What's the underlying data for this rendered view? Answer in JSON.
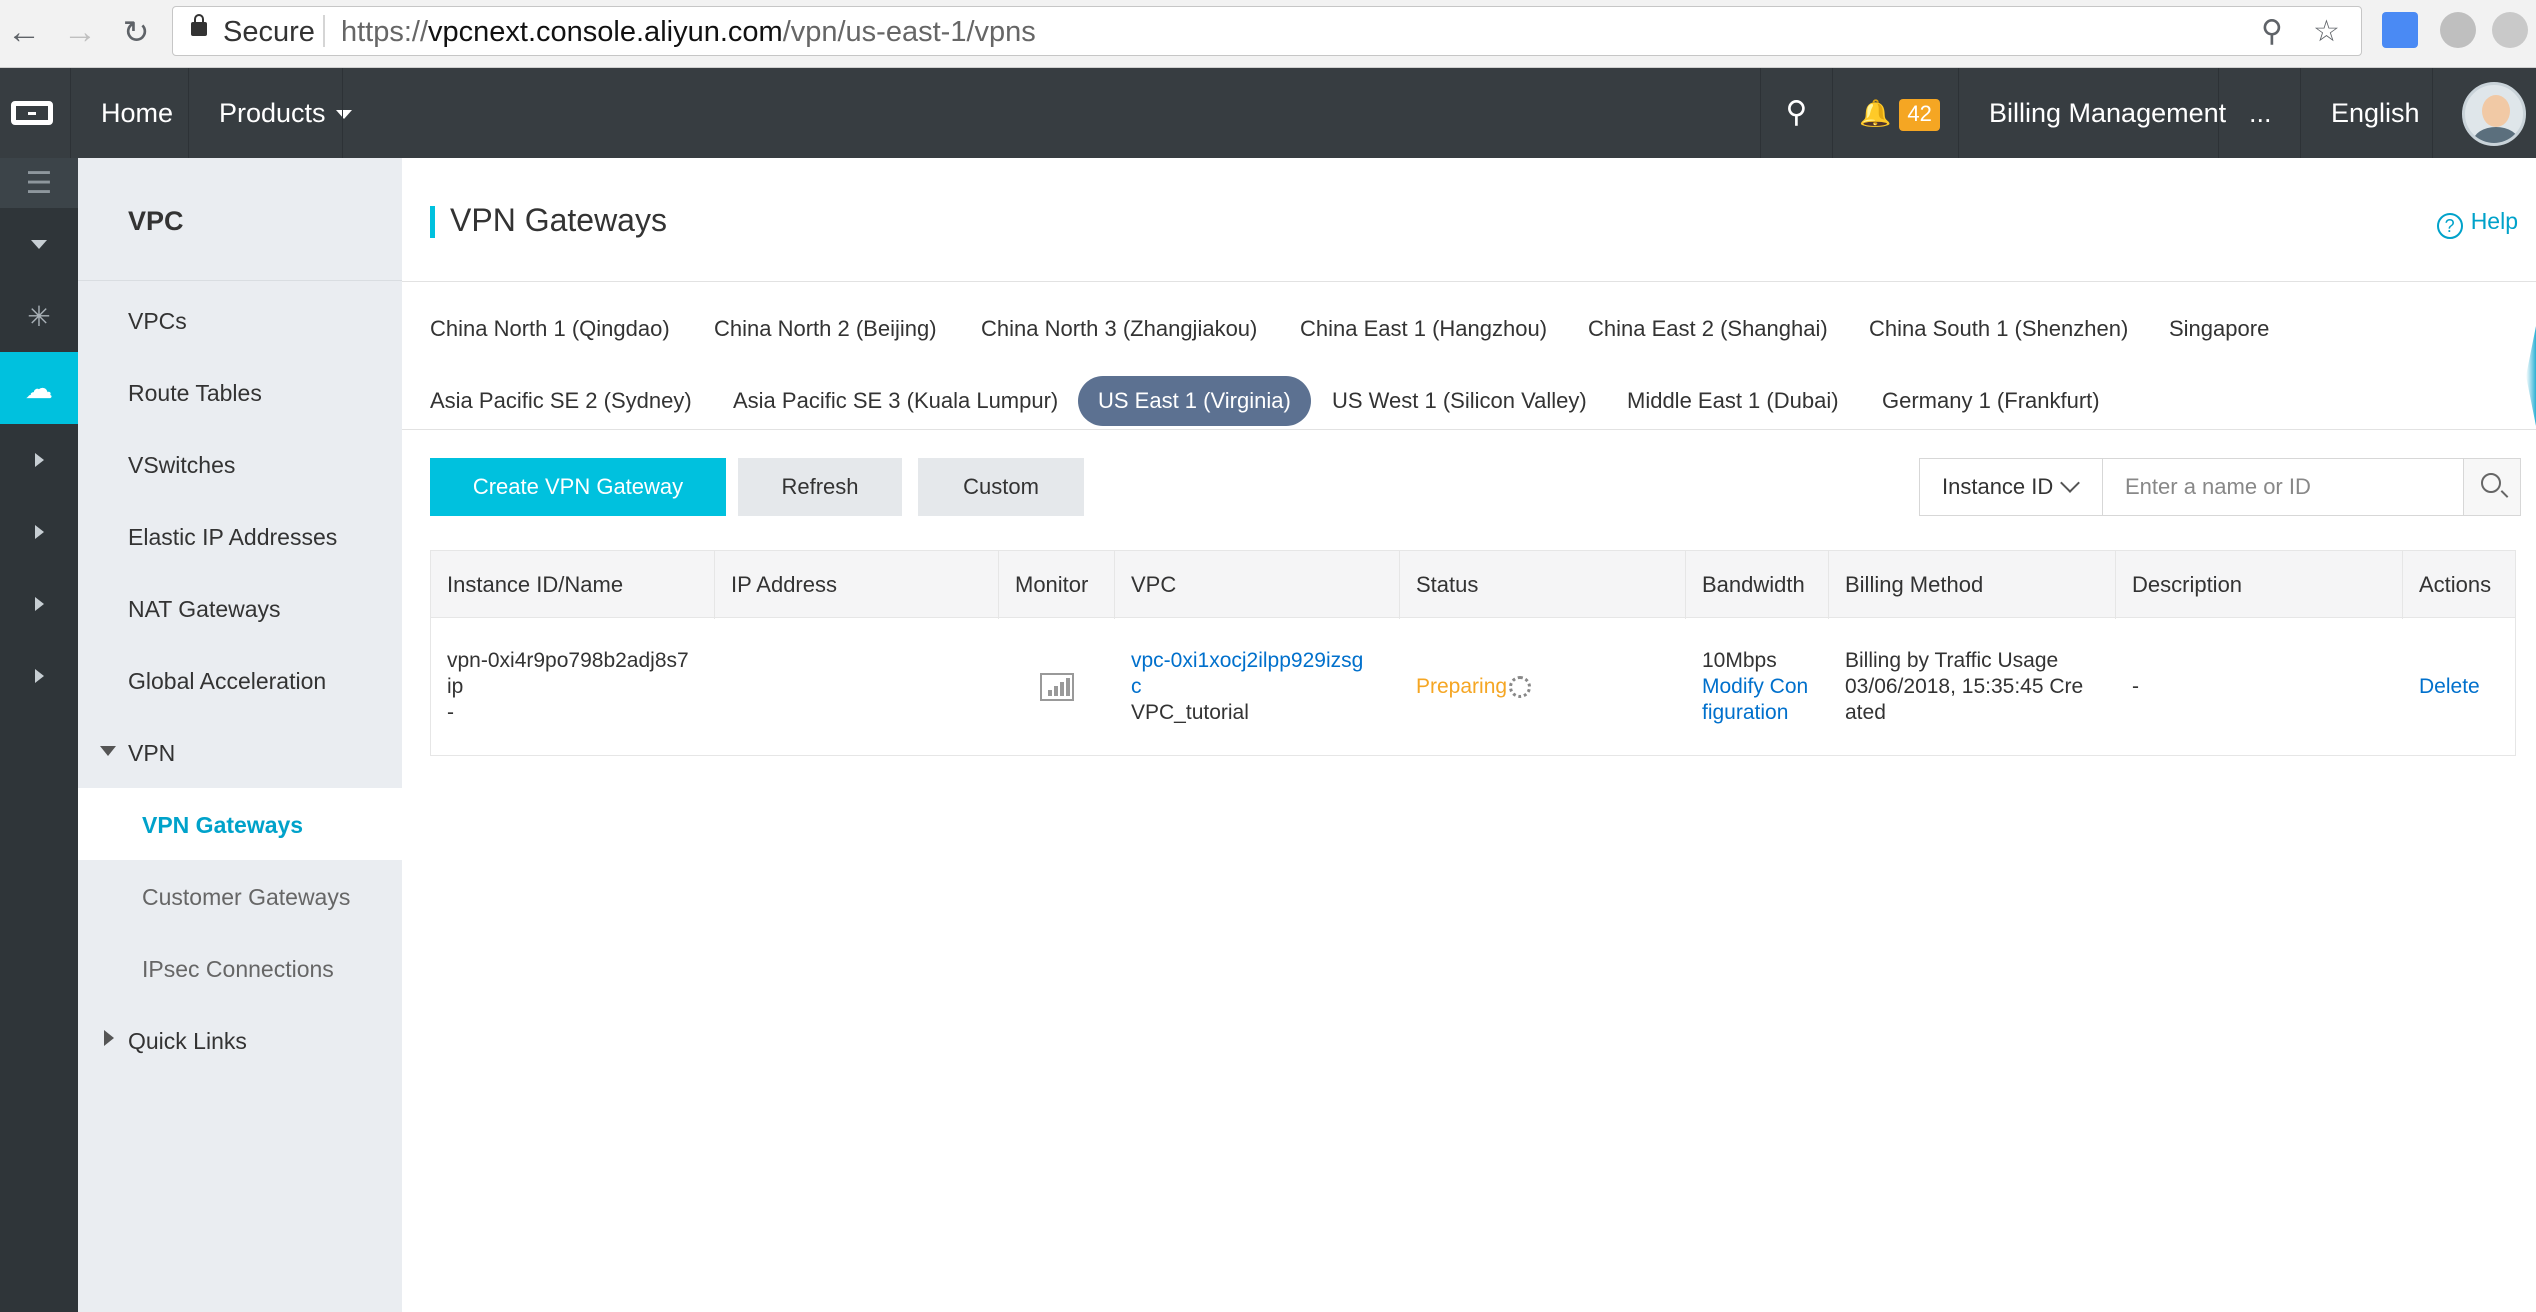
{
  "browser": {
    "secure_label": "Secure",
    "url_scheme": "https://",
    "url_host": "vpcnext.console.aliyun.com",
    "url_path": "/vpn/us-east-1/vpns"
  },
  "topnav": {
    "home": "Home",
    "products": "Products",
    "notification_count": "42",
    "billing": "Billing Management",
    "more": "...",
    "language": "English"
  },
  "sidebar": {
    "title": "VPC",
    "items": {
      "vpcs": "VPCs",
      "route_tables": "Route Tables",
      "vswitches": "VSwitches",
      "eip": "Elastic IP Addresses",
      "nat": "NAT Gateways",
      "global_accel": "Global Acceleration",
      "vpn": "VPN",
      "vpn_gateways": "VPN Gateways",
      "customer_gateways": "Customer Gateways",
      "ipsec": "IPsec Connections",
      "quick_links": "Quick Links"
    }
  },
  "page": {
    "title": "VPN Gateways",
    "help": "Help"
  },
  "regions": {
    "r1": "China North 1 (Qingdao)",
    "r2": "China North 2 (Beijing)",
    "r3": "China North 3 (Zhangjiakou)",
    "r4": "China East 1 (Hangzhou)",
    "r5": "China East 2 (Shanghai)",
    "r6": "China South 1 (Shenzhen)",
    "r7": "Singapore",
    "r8": "Asia Pacific SE 2 (Sydney)",
    "r9": "Asia Pacific SE 3 (Kuala Lumpur)",
    "r10": "US East 1 (Virginia)",
    "r11": "US West 1 (Silicon Valley)",
    "r12": "Middle East 1 (Dubai)",
    "r13": "Germany 1 (Frankfurt)",
    "selected": "US East 1 (Virginia)"
  },
  "toolbar": {
    "create": "Create VPN Gateway",
    "refresh": "Refresh",
    "custom": "Custom",
    "search_type": "Instance ID",
    "search_placeholder": "Enter a name or ID"
  },
  "table": {
    "columns": {
      "instance": "Instance ID/Name",
      "ip": "IP Address",
      "monitor": "Monitor",
      "vpc": "VPC",
      "status": "Status",
      "bandwidth": "Bandwidth",
      "billing": "Billing Method",
      "description": "Description",
      "actions": "Actions"
    },
    "rows": [
      {
        "instance_id_l1": "vpn-0xi4r9po798b2adj8s7",
        "instance_id_l2": "ip",
        "name": "-",
        "vpc_id_l1": "vpc-0xi1xocj2ilpp929izsg",
        "vpc_id_l2": "c",
        "vpc_name": "VPC_tutorial",
        "status": "Preparing",
        "bandwidth": "10Mbps",
        "modify_l1": "Modify Con",
        "modify_l2": "figuration",
        "billing_l1": "Billing by Traffic Usage",
        "billing_l2": "03/06/2018, 15:35:45 Cre",
        "billing_l3": "ated",
        "description": "-",
        "action": "Delete"
      }
    ]
  },
  "colors": {
    "accent": "#00c1de",
    "nav_bg": "#373d41",
    "selected_region": "#5c7191",
    "status_preparing": "#f5a623",
    "link": "#0070cc"
  }
}
